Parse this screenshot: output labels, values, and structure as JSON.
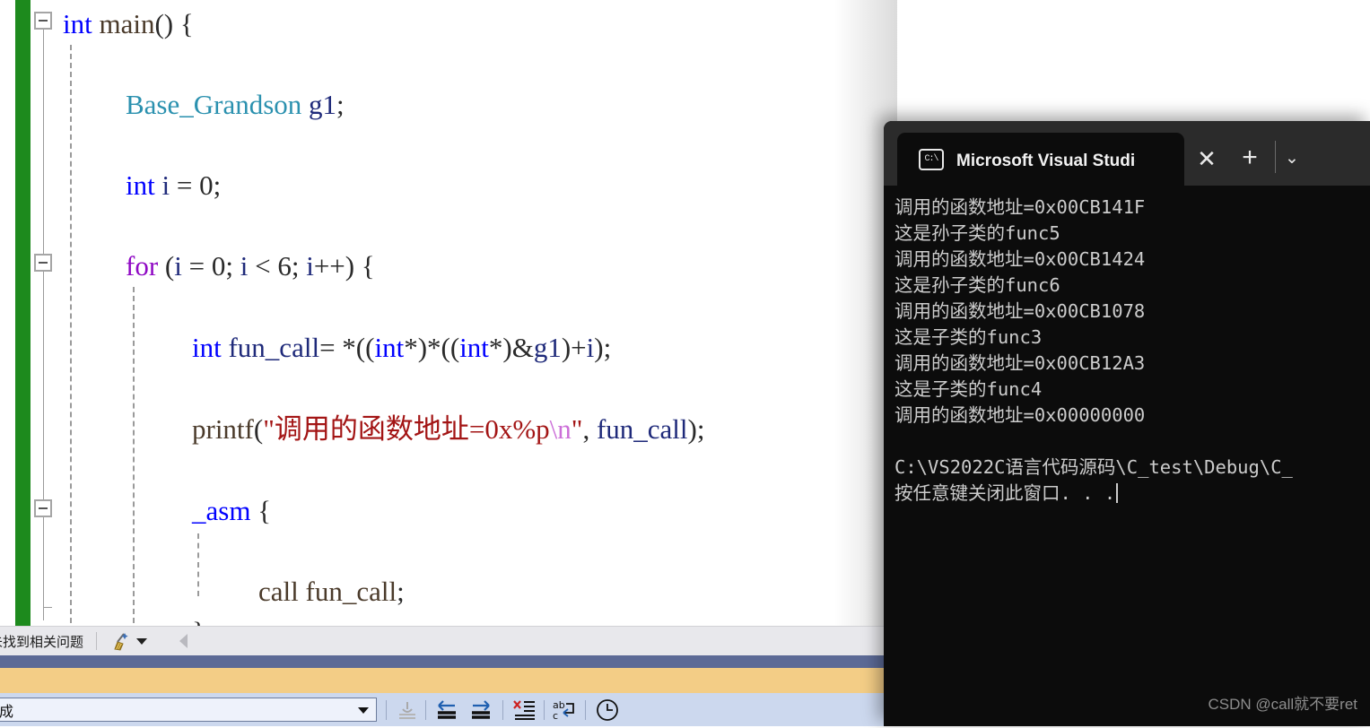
{
  "editor": {
    "change_bar_color": "#1d8a1d",
    "lines": [
      {
        "fold": "minus",
        "indent": 0,
        "tokens": [
          {
            "t": "int",
            "c": "kw"
          },
          {
            "t": " ",
            "c": "plain"
          },
          {
            "t": "main",
            "c": "plain"
          },
          {
            "t": "() {",
            "c": "punct"
          }
        ]
      },
      {
        "fold": "",
        "indent": 0,
        "tokens": []
      },
      {
        "fold": "",
        "indent": 1,
        "tokens": [
          {
            "t": "Base_Grandson",
            "c": "cls"
          },
          {
            "t": " ",
            "c": "plain"
          },
          {
            "t": "g1",
            "c": "var"
          },
          {
            "t": ";",
            "c": "punct"
          }
        ]
      },
      {
        "fold": "",
        "indent": 1,
        "tokens": [
          {
            "t": "int",
            "c": "kw"
          },
          {
            "t": " ",
            "c": "plain"
          },
          {
            "t": "i",
            "c": "var"
          },
          {
            "t": " = ",
            "c": "punct"
          },
          {
            "t": "0",
            "c": "punct"
          },
          {
            "t": ";",
            "c": "punct"
          }
        ]
      },
      {
        "fold": "minus",
        "indent": 1,
        "tokens": [
          {
            "t": "for",
            "c": "kw2"
          },
          {
            "t": " (",
            "c": "punct"
          },
          {
            "t": "i",
            "c": "var"
          },
          {
            "t": " = ",
            "c": "punct"
          },
          {
            "t": "0",
            "c": "punct"
          },
          {
            "t": "; ",
            "c": "punct"
          },
          {
            "t": "i",
            "c": "var"
          },
          {
            "t": " < ",
            "c": "punct"
          },
          {
            "t": "6",
            "c": "punct"
          },
          {
            "t": "; ",
            "c": "punct"
          },
          {
            "t": "i",
            "c": "var"
          },
          {
            "t": "++) {",
            "c": "punct"
          }
        ]
      },
      {
        "fold": "",
        "indent": 2,
        "tokens": [
          {
            "t": "int",
            "c": "kw"
          },
          {
            "t": " ",
            "c": "plain"
          },
          {
            "t": "fun_call",
            "c": "var"
          },
          {
            "t": "= *((",
            "c": "punct"
          },
          {
            "t": "int",
            "c": "kw"
          },
          {
            "t": "*)*((",
            "c": "punct"
          },
          {
            "t": "int",
            "c": "kw"
          },
          {
            "t": "*)&",
            "c": "punct"
          },
          {
            "t": "g1",
            "c": "var"
          },
          {
            "t": ")+",
            "c": "punct"
          },
          {
            "t": "i",
            "c": "var"
          },
          {
            "t": ");",
            "c": "punct"
          }
        ]
      },
      {
        "fold": "",
        "indent": 2,
        "tokens": [
          {
            "t": "printf",
            "c": "plain"
          },
          {
            "t": "(",
            "c": "punct"
          },
          {
            "t": "\"调用的函数地址=0x%p",
            "c": "str"
          },
          {
            "t": "\\n",
            "c": "esc"
          },
          {
            "t": "\"",
            "c": "str"
          },
          {
            "t": ", ",
            "c": "punct"
          },
          {
            "t": "fun_call",
            "c": "var"
          },
          {
            "t": ");",
            "c": "punct"
          }
        ]
      },
      {
        "fold": "minus",
        "indent": 2,
        "tokens": [
          {
            "t": "_asm",
            "c": "kw"
          },
          {
            "t": " {",
            "c": "punct"
          }
        ]
      },
      {
        "fold": "",
        "indent": 3,
        "tokens": [
          {
            "t": "call",
            "c": "plain"
          },
          {
            "t": " ",
            "c": "plain"
          },
          {
            "t": "fun_call",
            "c": "plain"
          },
          {
            "t": ";",
            "c": "punct"
          }
        ]
      },
      {
        "fold": "endmark",
        "indent": 2,
        "tokens": [
          {
            "t": "}",
            "c": "punct"
          }
        ]
      }
    ]
  },
  "issue_bar": {
    "status_text": "未找到相关问题",
    "broom_icon": "broom-icon",
    "dropdown_icon": "chevron-down-icon",
    "prev_icon": "previous-arrow-icon"
  },
  "bottom_toolbar": {
    "scope_value": "成",
    "scope_placeholder": "",
    "dropdown_icon": "chevron-down-icon",
    "buttons": [
      {
        "name": "indent-guide-button",
        "icon": "anchor-underline-icon",
        "disabled": true
      },
      {
        "name": "move-left-button",
        "icon": "arrow-left-lines-icon",
        "disabled": false
      },
      {
        "name": "move-right-button",
        "icon": "arrow-right-lines-icon",
        "disabled": false
      },
      {
        "name": "clear-all-button",
        "icon": "clear-list-x-icon",
        "disabled": false
      },
      {
        "name": "toggle-word-wrap-button",
        "icon": "abc-wrap-icon",
        "disabled": false
      },
      {
        "name": "history-button",
        "icon": "clock-icon",
        "disabled": false
      }
    ]
  },
  "bands": {
    "blue": "#5c6a96",
    "tan": "#f3cd86",
    "bottom": "#ccd8ee"
  },
  "console": {
    "tab_title": "Microsoft Visual Studio 调试控制台",
    "tab_icon": "terminal-cmd-icon",
    "close_label": "✕",
    "new_tab_label": "+",
    "menu_label": "⌄",
    "lines": [
      "调用的函数地址=0x00CB141F",
      "这是孙子类的func5",
      "调用的函数地址=0x00CB1424",
      "这是孙子类的func6",
      "调用的函数地址=0x00CB1078",
      "这是子类的func3",
      "调用的函数地址=0x00CB12A3",
      "这是子类的func4",
      "调用的函数地址=0x00000000",
      "",
      "C:\\VS2022C语言代码源码\\C_test\\Debug\\C_",
      "按任意键关闭此窗口. . ."
    ],
    "watermark": "CSDN @call就不要ret"
  }
}
